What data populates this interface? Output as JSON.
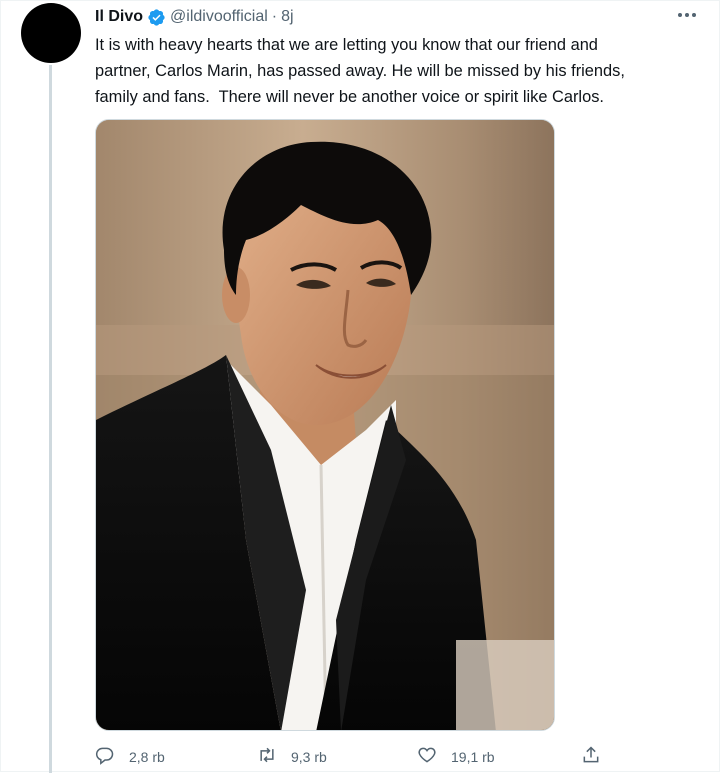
{
  "tweet": {
    "display_name": "Il Divo",
    "handle": "@ildivoofficial",
    "separator": "·",
    "time": "8j",
    "text": "It is with heavy hearts that we are letting you know that our friend and\npartner, Carlos Marin, has passed away. He will be missed by his friends,\nfamily and fans.  There will never be another voice or spirit like Carlos.",
    "verified": true,
    "icons": {
      "verified": "verified-badge-icon",
      "more": "more-horizontal-icon",
      "reply": "reply-icon",
      "retweet": "retweet-icon",
      "like": "heart-icon",
      "share": "share-icon"
    }
  },
  "actions": {
    "replies": "2,8 rb",
    "retweets": "9,3 rb",
    "likes": "19,1 rb"
  },
  "colors": {
    "verified": "#1d9bf0",
    "muted": "#536471",
    "text": "#0f1419",
    "thread_line": "#cfd9de"
  }
}
